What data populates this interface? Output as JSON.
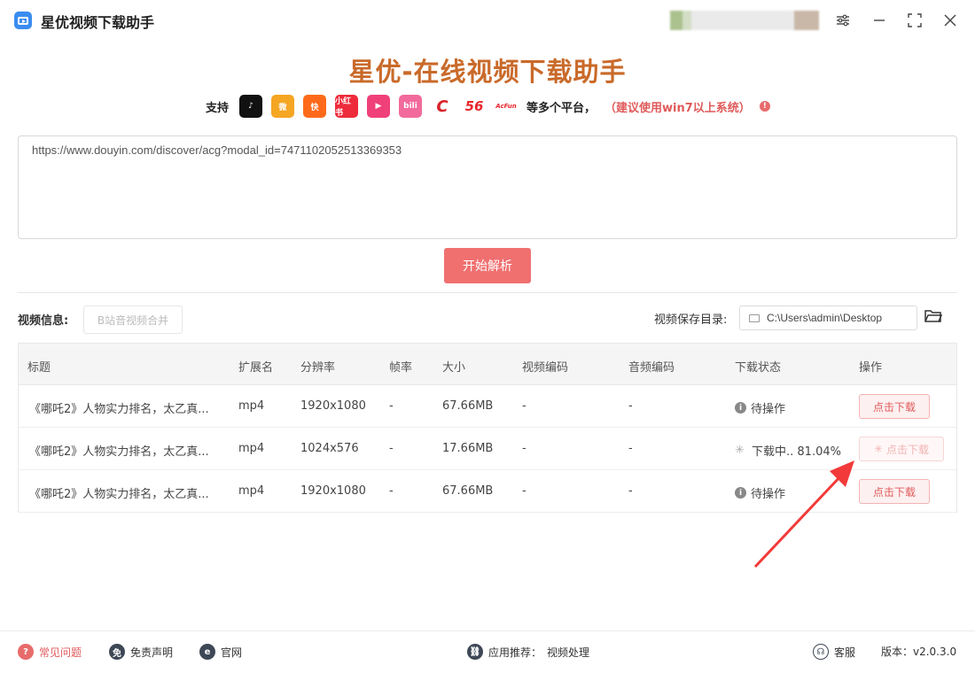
{
  "app": {
    "title": "星优视频下载助手"
  },
  "header": {
    "main_title": "星优-在线视频下载助手",
    "support_label": "支持",
    "platforms": [
      {
        "name": "douyin-icon",
        "color": "#111111",
        "text": "♪"
      },
      {
        "name": "weibo-icon",
        "color": "#f5a623",
        "text": "微"
      },
      {
        "name": "kuaishou-icon",
        "color": "#ff6a1a",
        "text": "快"
      },
      {
        "name": "xiaohongshu-icon",
        "color": "#ee2b3b",
        "text": "小红书"
      },
      {
        "name": "xigua-icon",
        "color": "#f0407a",
        "text": "▶"
      },
      {
        "name": "bilibili-icon",
        "color": "#f26a9b",
        "text": "bili"
      },
      {
        "name": "cctv-icon",
        "color": "#ffffff",
        "text": "C"
      },
      {
        "name": "56-icon",
        "color": "#ffffff",
        "text": "56"
      },
      {
        "name": "acfun-icon",
        "color": "#ffffff",
        "text": "AcFun"
      }
    ],
    "more_text": "等多个平台，",
    "note_text": "（建议使用win7以上系统）"
  },
  "url_input": {
    "value": "https://www.douyin.com/discover/acg?modal_id=7471102052513369353"
  },
  "parse_button": "开始解析",
  "video_info_label": "视频信息:",
  "merge_button": "B站音视频合并",
  "save_dir": {
    "label": "视频保存目录:",
    "path": "C:\\Users\\admin\\Desktop"
  },
  "table": {
    "columns": [
      "标题",
      "扩展名",
      "分辨率",
      "帧率",
      "大小",
      "视频编码",
      "音频编码",
      "下载状态",
      "操作"
    ],
    "rows": [
      {
        "title": "《哪吒2》人物实力排名，太乙真...",
        "ext": "mp4",
        "resolution": "1920x1080",
        "fps": "-",
        "size": "67.66MB",
        "vcodec": "-",
        "acodec": "-",
        "status": "待操作",
        "action": "点击下载"
      },
      {
        "title": "《哪吒2》人物实力排名，太乙真...",
        "ext": "mp4",
        "resolution": "1024x576",
        "fps": "-",
        "size": "17.66MB",
        "vcodec": "-",
        "acodec": "-",
        "status": "下载中.. 81.04%",
        "action": "点击下载"
      },
      {
        "title": "《哪吒2》人物实力排名，太乙真...",
        "ext": "mp4",
        "resolution": "1920x1080",
        "fps": "-",
        "size": "67.66MB",
        "vcodec": "-",
        "acodec": "-",
        "status": "待操作",
        "action": "点击下载"
      }
    ]
  },
  "footer": {
    "faq": "常见问题",
    "disclaimer": "免责声明",
    "website": "官网",
    "recommend": "应用推荐：",
    "recommend_item": "视频处理",
    "service": "客服",
    "version": "版本：v2.0.3.0"
  },
  "colors": {
    "accent": "#f07070",
    "title_gradient": "#c96a2a",
    "note": "#e05a5a"
  }
}
